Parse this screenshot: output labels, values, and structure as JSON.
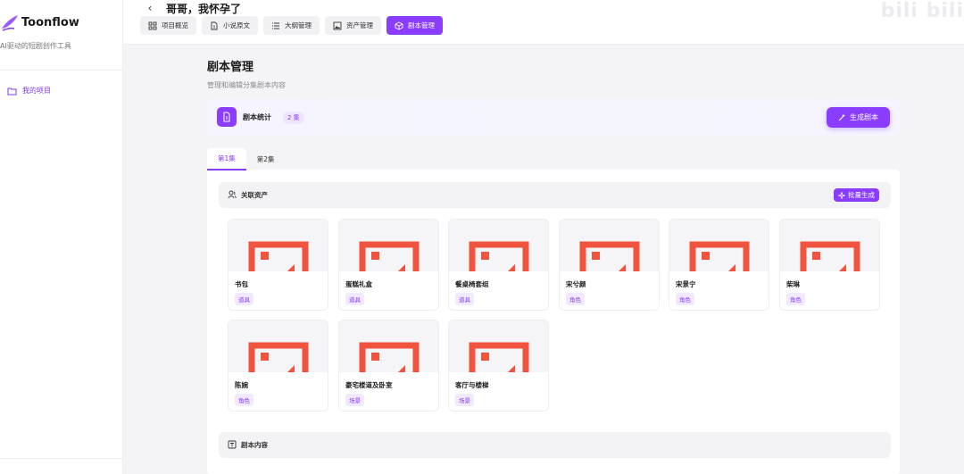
{
  "brand": {
    "name": "Toonflow",
    "tagline": "AI驱动的短剧创作工具",
    "logo_icon": "quill-icon"
  },
  "sidebar": {
    "items": [
      {
        "label": "我的项目",
        "icon": "folder-icon",
        "active": true
      }
    ]
  },
  "header": {
    "back_icon": "chevron-left-icon",
    "project_title": "哥哥，我怀孕了",
    "tabs": [
      {
        "label": "项目概览",
        "icon": "grid-icon",
        "active": false
      },
      {
        "label": "小说原文",
        "icon": "document-icon",
        "active": false
      },
      {
        "label": "大纲管理",
        "icon": "list-icon",
        "active": false
      },
      {
        "label": "资产管理",
        "icon": "image-icon",
        "active": false
      },
      {
        "label": "剧本管理",
        "icon": "box-icon",
        "active": true
      }
    ],
    "watermark": "bili bili"
  },
  "main": {
    "title": "剧本管理",
    "subtitle": "管理和编辑分集剧本内容",
    "stats": {
      "label": "剧本统计",
      "badge": "2 集",
      "icon": "script-icon"
    },
    "generate_button": "生成剧本",
    "episode_tabs": [
      {
        "label": "第1集",
        "active": true
      },
      {
        "label": "第2集",
        "active": false
      }
    ],
    "assets_section": {
      "title": "关联资产",
      "icon": "users-icon",
      "batch_button": "批量生成",
      "items": [
        {
          "name": "书包",
          "tag": "道具"
        },
        {
          "name": "蛋糕礼盒",
          "tag": "道具"
        },
        {
          "name": "餐桌椅套组",
          "tag": "道具"
        },
        {
          "name": "宋兮颜",
          "tag": "角色"
        },
        {
          "name": "宋景宁",
          "tag": "角色"
        },
        {
          "name": "柴琳",
          "tag": "角色"
        },
        {
          "name": "陈婉",
          "tag": "角色"
        },
        {
          "name": "豪宅楼道及卧室",
          "tag": "场景"
        },
        {
          "name": "客厅与楼梯",
          "tag": "场景"
        }
      ]
    },
    "content_section": {
      "title": "剧本内容",
      "icon": "text-box-icon"
    }
  },
  "colors": {
    "accent": "#8b3dff",
    "placeholder_red": "#f0533e",
    "tag_bg": "#f1eaff"
  }
}
